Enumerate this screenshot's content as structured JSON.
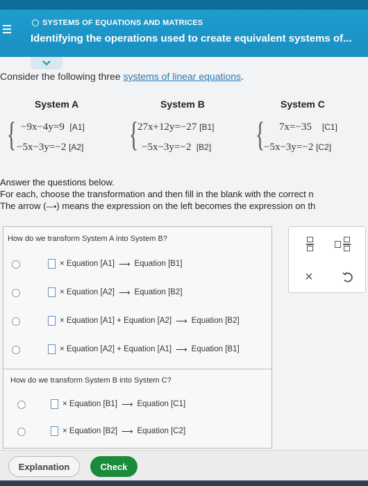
{
  "header": {
    "topic": "SYSTEMS OF EQUATIONS AND MATRICES",
    "title": "Identifying the operations used to create equivalent systems of..."
  },
  "intro": {
    "prefix": "Consider the following three ",
    "link": "systems of linear equations",
    "suffix": "."
  },
  "systems": {
    "a": {
      "label": "System A",
      "eq1": "−9x−4y=9",
      "tag1": "[A1]",
      "eq2": "−5x−3y=−2",
      "tag2": "[A2]"
    },
    "b": {
      "label": "System B",
      "eq1": "27x+12y=−27",
      "tag1": "[B1]",
      "eq2": "−5x−3y=−2",
      "tag2": "[B2]"
    },
    "c": {
      "label": "System C",
      "eq1": "7x=−35",
      "tag1": "[C1]",
      "eq2": "−5x−3y=−2",
      "tag2": "[C2]"
    }
  },
  "answer": {
    "line1": "Answer the questions below.",
    "line2": "For each, choose the transformation and then fill in the blank with the correct n",
    "line3_pre": "The arrow (",
    "line3_arrow": "—•",
    "line3_post": ") means the expression on the left becomes the expression on th"
  },
  "question1": {
    "prompt": "How do we transform System A into System B?",
    "options": [
      {
        "text": "× Equation [A1]",
        "target": "Equation [B1]"
      },
      {
        "text": "× Equation [A2]",
        "target": "Equation [B2]"
      },
      {
        "text": "× Equation [A1] + Equation [A2]",
        "target": "Equation [B2]"
      },
      {
        "text": "× Equation [A2] + Equation [A1]",
        "target": "Equation [B1]"
      }
    ]
  },
  "question2": {
    "prompt": "How do we transform System B into System C?",
    "options": [
      {
        "text": "× Equation [B1]",
        "target": "Equation [C1]"
      },
      {
        "text": "× Equation [B2]",
        "target": "Equation [C2]"
      }
    ]
  },
  "arrow_glyph": "⟶",
  "buttons": {
    "explanation": "Explanation",
    "check": "Check"
  },
  "colors": {
    "header": "#1f9fd0",
    "check": "#1b8a3a",
    "link": "#2a7ab8"
  }
}
